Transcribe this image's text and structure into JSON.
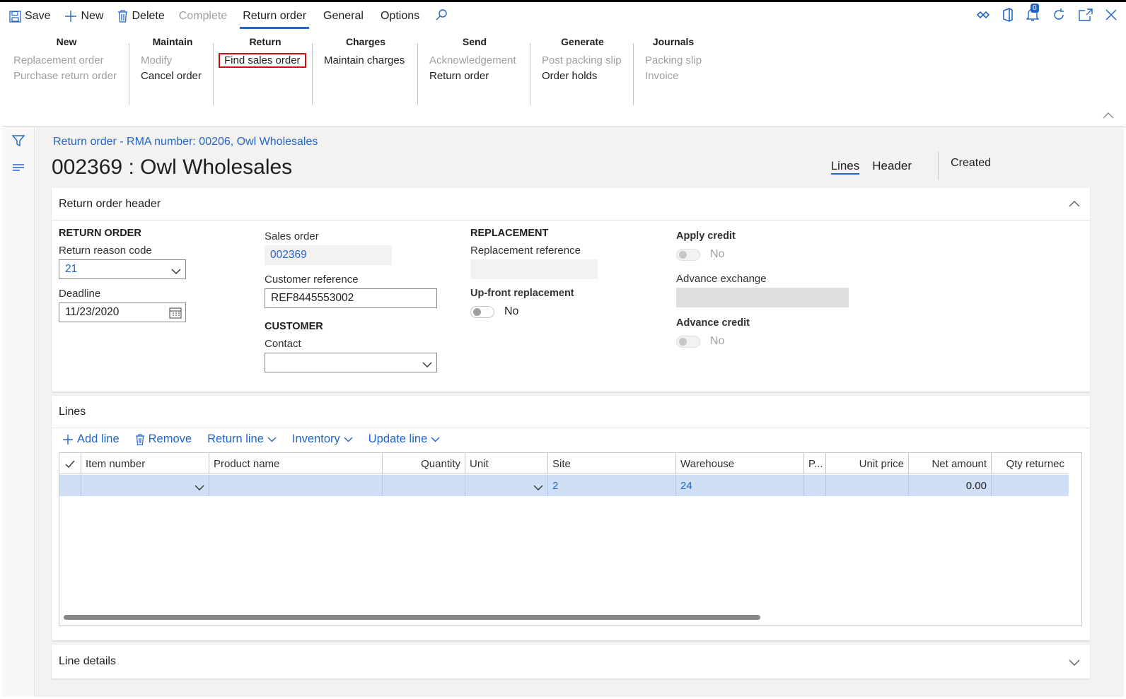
{
  "actionbar": {
    "save": "Save",
    "new": "New",
    "delete": "Delete",
    "complete": "Complete",
    "tabs": [
      "Return order",
      "General",
      "Options"
    ],
    "notification_count": "0"
  },
  "ribbon": {
    "groups": [
      {
        "title": "New",
        "items": [
          "Replacement order",
          "Purchase return order"
        ]
      },
      {
        "title": "Maintain",
        "items": [
          "Modify",
          "Cancel order"
        ]
      },
      {
        "title": "Return",
        "items": [
          "Find sales order"
        ]
      },
      {
        "title": "Charges",
        "items": [
          "Maintain charges"
        ]
      },
      {
        "title": "Send",
        "items": [
          "Acknowledgement",
          "Return order"
        ]
      },
      {
        "title": "Generate",
        "items": [
          "Post packing slip",
          "Order holds"
        ]
      },
      {
        "title": "Journals",
        "items": [
          "Packing slip",
          "Invoice"
        ]
      }
    ]
  },
  "page": {
    "breadcrumb": "Return order - RMA number: 00206, Owl Wholesales",
    "title": "002369 : Owl Wholesales",
    "view_tabs": [
      "Lines",
      "Header"
    ],
    "created": "Created"
  },
  "header_card": {
    "title": "Return order header",
    "return_order_section": "RETURN ORDER",
    "return_reason_code_label": "Return reason code",
    "return_reason_code": "21",
    "deadline_label": "Deadline",
    "deadline": "11/23/2020",
    "sales_order_label": "Sales order",
    "sales_order": "002369",
    "customer_reference_label": "Customer reference",
    "customer_reference": "REF8445553002",
    "customer_section": "CUSTOMER",
    "contact_label": "Contact",
    "contact": "",
    "replacement_section": "REPLACEMENT",
    "replacement_reference_label": "Replacement reference",
    "upfront_label": "Up-front replacement",
    "upfront_value": "No",
    "apply_credit_label": "Apply credit",
    "apply_credit_value": "No",
    "advance_exchange_label": "Advance exchange",
    "advance_credit_label": "Advance credit",
    "advance_credit_value": "No"
  },
  "lines_card": {
    "title": "Lines",
    "toolbar": {
      "add_line": "Add line",
      "remove": "Remove",
      "return_line": "Return line",
      "inventory": "Inventory",
      "update_line": "Update line"
    },
    "columns": [
      "Item number",
      "Product name",
      "Quantity",
      "Unit",
      "Site",
      "Warehouse",
      "P...",
      "Unit price",
      "Net amount",
      "Qty returnec"
    ],
    "row": {
      "item_number": "",
      "product_name": "",
      "quantity": "",
      "unit": "",
      "site": "2",
      "warehouse": "24",
      "p": "",
      "unit_price": "",
      "net_amount": "0.00",
      "qty_returned": ""
    }
  },
  "line_details_card": {
    "title": "Line details"
  },
  "colors": {
    "accent": "#2266c9",
    "highlight_border": "#d20f0f",
    "selected_row": "#cfe0f6"
  }
}
